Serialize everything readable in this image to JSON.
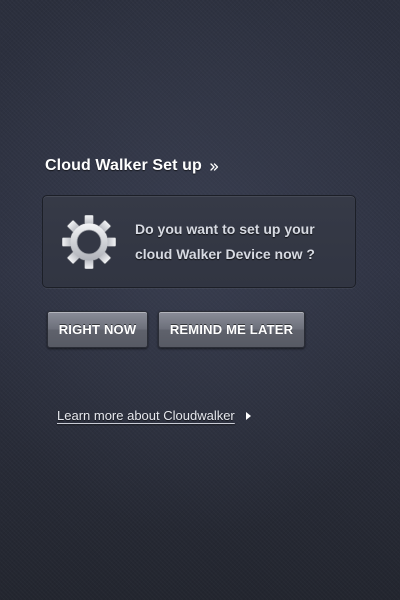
{
  "header": {
    "title": "Cloud Walker Set up",
    "title_icon": "double-chevron-right-icon"
  },
  "prompt": {
    "icon": "gear-icon",
    "line1": "Do you want to set up your",
    "line2": "cloud Walker Device now ?"
  },
  "actions": {
    "right_now_label": "RIGHT NOW",
    "remind_later_label": "REMIND ME LATER"
  },
  "learn_more": {
    "label": "Learn more about Cloudwalker",
    "icon": "caret-right-icon"
  },
  "colors": {
    "background": "#2a2e3b",
    "panel": "#343845",
    "button": "#6d707b",
    "text": "#ffffff",
    "prompt_text": "#d7dae2"
  }
}
